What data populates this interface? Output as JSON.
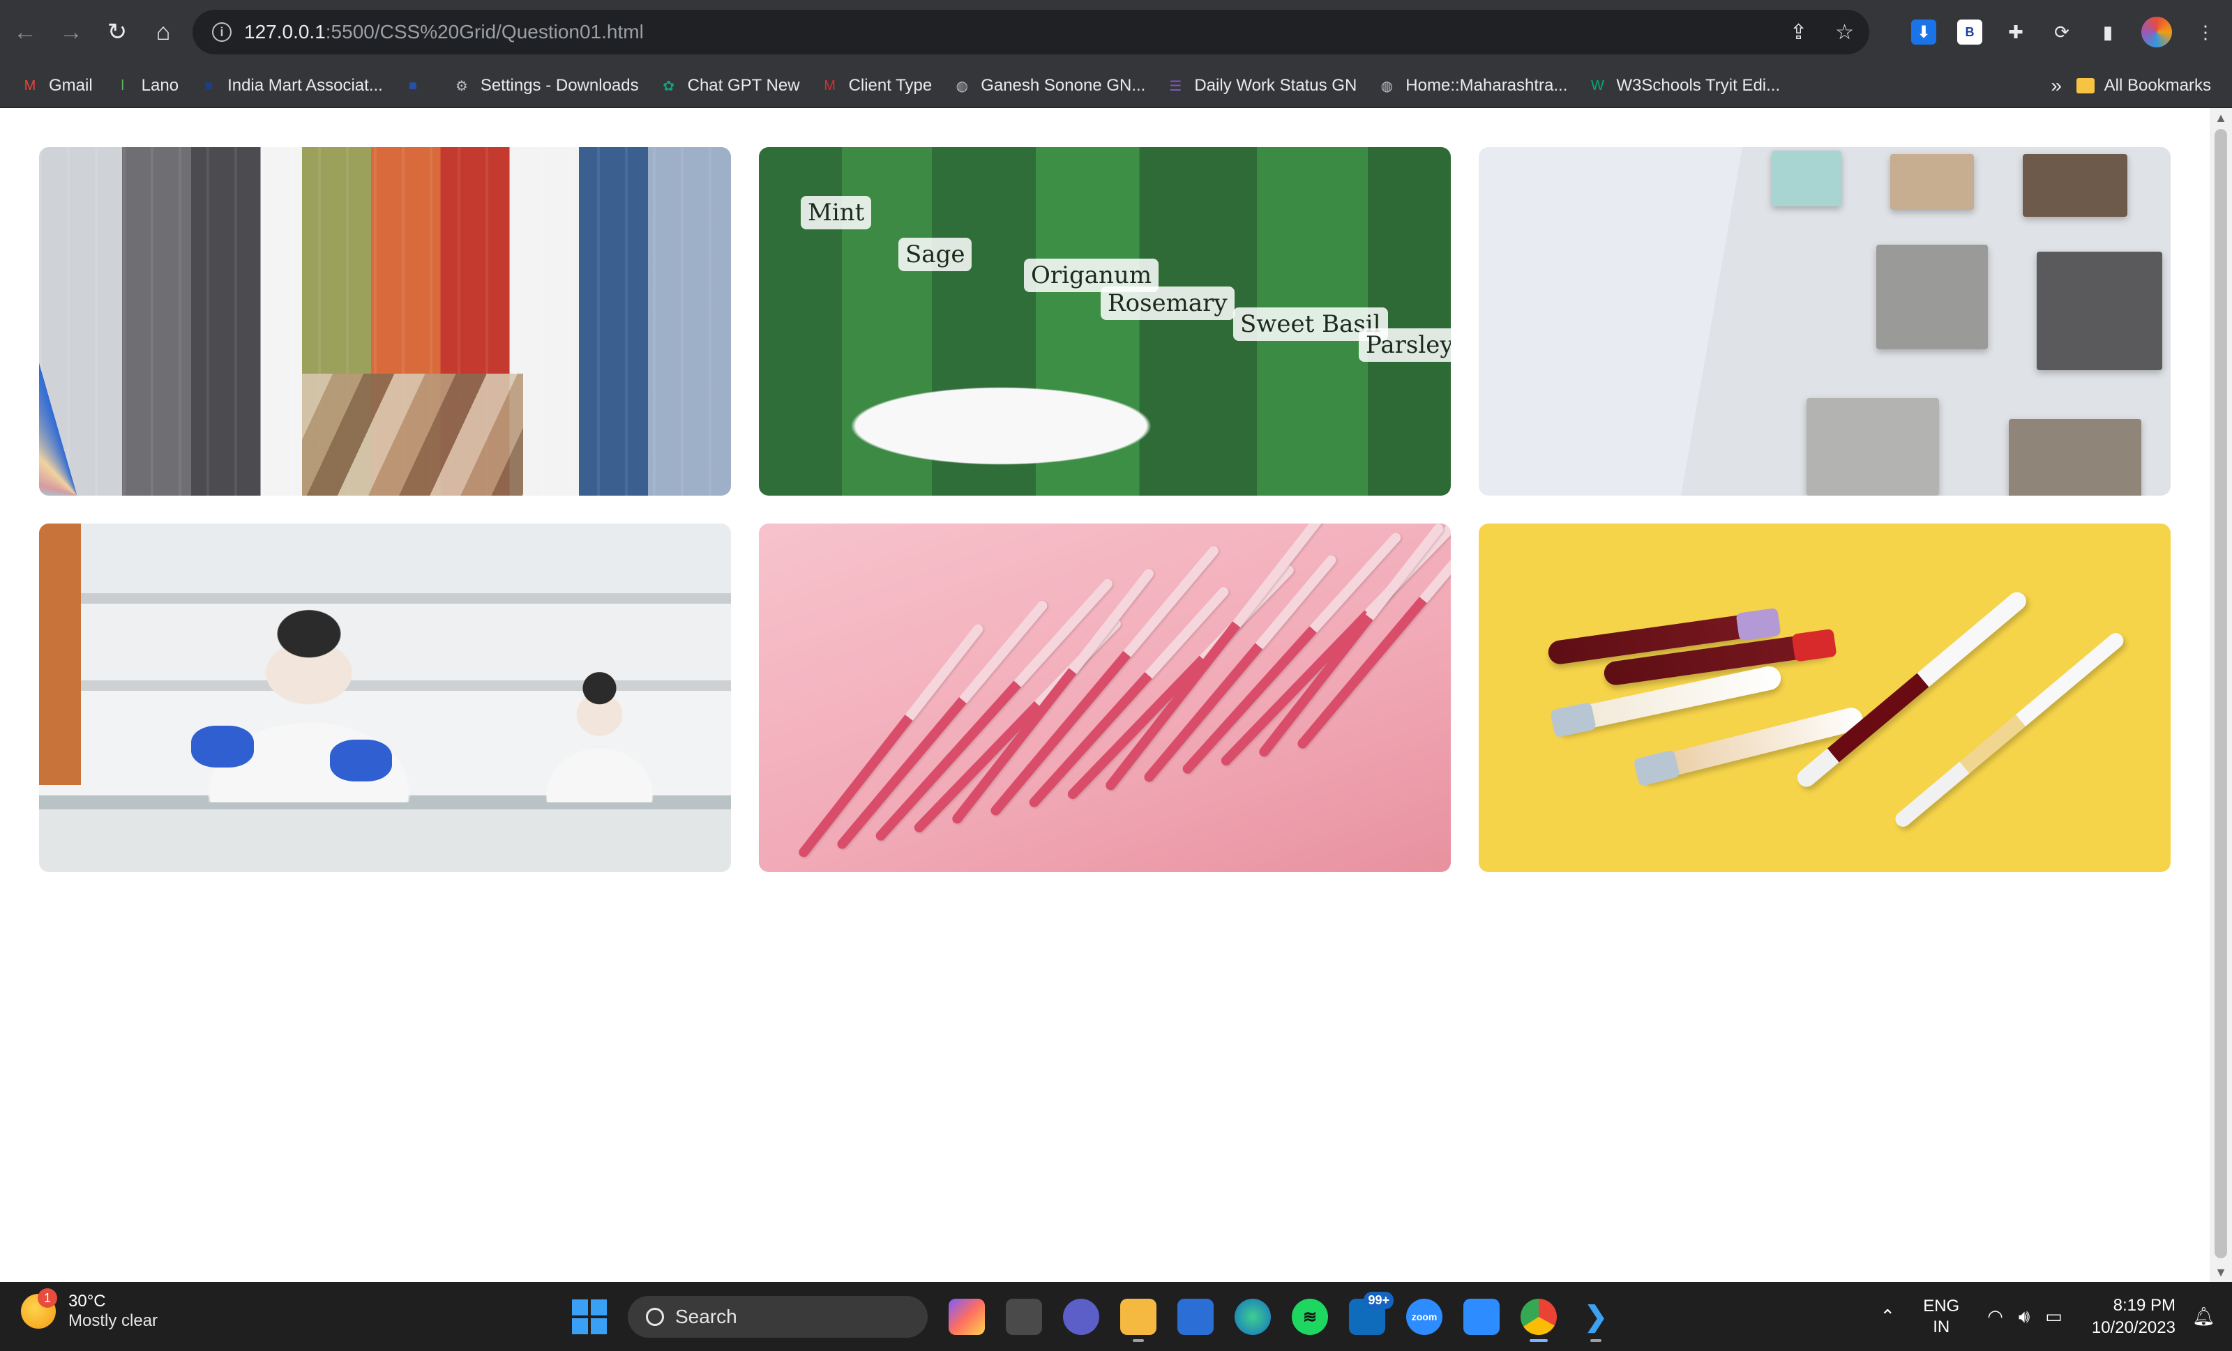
{
  "browser": {
    "nav": {
      "back_icon": "←",
      "forward_icon": "→",
      "reload_icon": "↻",
      "home_icon": "⌂"
    },
    "url": {
      "host": "127.0.0.1",
      "path": ":5500/CSS%20Grid/Question01.html"
    },
    "bookmarks": [
      {
        "label": "Gmail",
        "icon": "M",
        "color": "#ea4335"
      },
      {
        "label": "Lano",
        "icon": "l",
        "color": "#5cb85c"
      },
      {
        "label": "India Mart Associat...",
        "icon": "■",
        "color": "#1a3e8a"
      },
      {
        "label": "",
        "icon": "■",
        "color": "#2a4fa8"
      },
      {
        "label": "Settings - Downloads",
        "icon": "⚙",
        "color": "#bdc1c6"
      },
      {
        "label": "Chat GPT New",
        "icon": "✿",
        "color": "#10a37f"
      },
      {
        "label": "Client Type",
        "icon": "M",
        "color": "#d32f2f"
      },
      {
        "label": "Ganesh Sonone GN...",
        "icon": "◍",
        "color": "#bdc1c6"
      },
      {
        "label": "Daily Work Status GN",
        "icon": "☰",
        "color": "#7e57c2"
      },
      {
        "label": "Home::Maharashtra...",
        "icon": "◍",
        "color": "#bdc1c6"
      },
      {
        "label": "W3Schools Tryit Edi...",
        "icon": "W",
        "color": "#04aa6d"
      }
    ],
    "bookmarks_more": "»",
    "all_bookmarks": "All Bookmarks"
  },
  "gallery": {
    "images": [
      {
        "subject": "fabric-swatches"
      },
      {
        "subject": "herb-jars",
        "labels": [
          "Mint",
          "Sage",
          "Origanum",
          "Rosemary",
          "Sweet Basil",
          "Parsley"
        ]
      },
      {
        "subject": "material-samples"
      },
      {
        "subject": "lab-scientist"
      },
      {
        "subject": "pink-syringes"
      },
      {
        "subject": "blood-tubes"
      }
    ]
  },
  "taskbar": {
    "weather": {
      "badge": "1",
      "temp": "30°C",
      "condition": "Mostly clear"
    },
    "search_label": "Search",
    "outlook_badge": "99+",
    "zoom_label": "zoom",
    "language": {
      "line1": "ENG",
      "line2": "IN"
    },
    "clock": {
      "time": "8:19 PM",
      "date": "10/20/2023"
    }
  }
}
